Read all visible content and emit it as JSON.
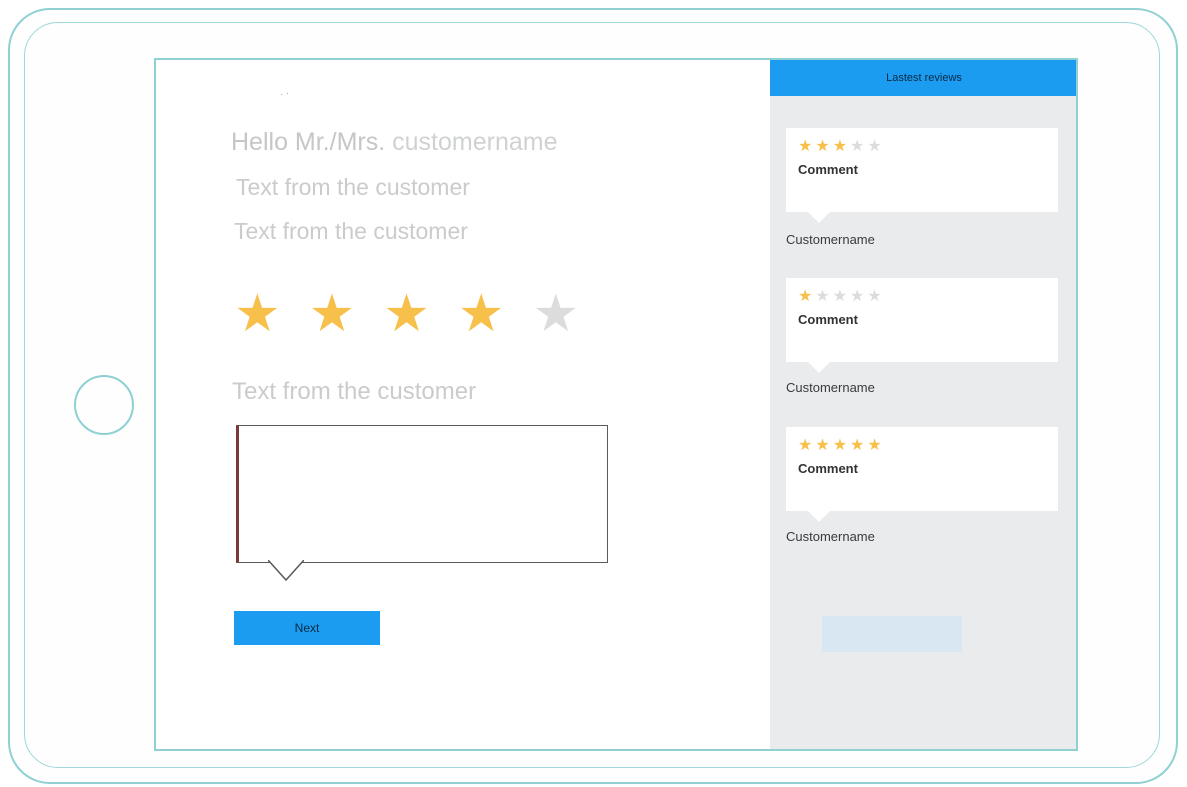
{
  "main": {
    "greeting_prefix": "Hello Mr./Mrs.",
    "greeting_name": "customername",
    "text_line_1": "Text from the customer",
    "text_line_2": "Text from the customer",
    "rating": {
      "value": 4,
      "max": 5
    },
    "text_line_3": "Text from the customer",
    "comment_value": "",
    "next_label": "Next"
  },
  "sidebar": {
    "title": "Lastest reviews",
    "reviews": [
      {
        "rating": 3,
        "max": 5,
        "comment": "Comment",
        "customer": "Customername"
      },
      {
        "rating": 1,
        "max": 5,
        "comment": "Comment",
        "customer": "Customername"
      },
      {
        "rating": 5,
        "max": 5,
        "comment": "Comment",
        "customer": "Customername"
      }
    ]
  },
  "colors": {
    "accent": "#1b9cf0",
    "star_on": "#f7c04a",
    "star_off": "#dcdcdc",
    "device_outline": "#8fd0d3"
  },
  "icons": {
    "star": "star-icon",
    "home": "home-button-icon"
  }
}
